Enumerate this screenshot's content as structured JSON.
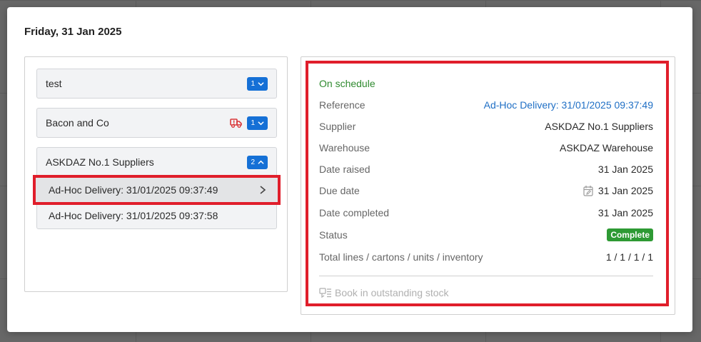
{
  "modal": {
    "title": "Friday, 31 Jan 2025"
  },
  "groups": [
    {
      "name": "test",
      "count": "1",
      "expanded": false
    },
    {
      "name": "Bacon and Co",
      "count": "1",
      "expanded": false,
      "icon": "truck-alert-icon"
    },
    {
      "name": "ASKDAZ No.1 Suppliers",
      "count": "2",
      "expanded": true,
      "deliveries": [
        {
          "label": "Ad-Hoc Delivery: 31/01/2025 09:37:49",
          "selected": true
        },
        {
          "label": "Ad-Hoc Delivery: 31/01/2025 09:37:58",
          "selected": false
        }
      ]
    }
  ],
  "details": {
    "schedule_status": "On schedule",
    "rows": [
      {
        "key": "Reference",
        "value": "Ad-Hoc Delivery: 31/01/2025 09:37:49"
      },
      {
        "key": "Supplier",
        "value": "ASKDAZ No.1 Suppliers"
      },
      {
        "key": "Warehouse",
        "value": "ASKDAZ Warehouse"
      },
      {
        "key": "Date raised",
        "value": "31 Jan 2025"
      },
      {
        "key": "Due date",
        "value": "31 Jan 2025"
      },
      {
        "key": "Date completed",
        "value": "31 Jan 2025"
      },
      {
        "key": "Status",
        "value": "Complete"
      },
      {
        "key": "Total lines / cartons / units / inventory",
        "value": "1 / 1 / 1 / 1"
      }
    ],
    "book_in_label": "Book in outstanding stock"
  },
  "colors": {
    "accent_blue": "#1570d6",
    "link_blue": "#1f6fc5",
    "success_green": "#2e9a34",
    "schedule_green": "#2f8a2f",
    "highlight_red": "#e01e2b",
    "alert_red": "#d9383a"
  }
}
